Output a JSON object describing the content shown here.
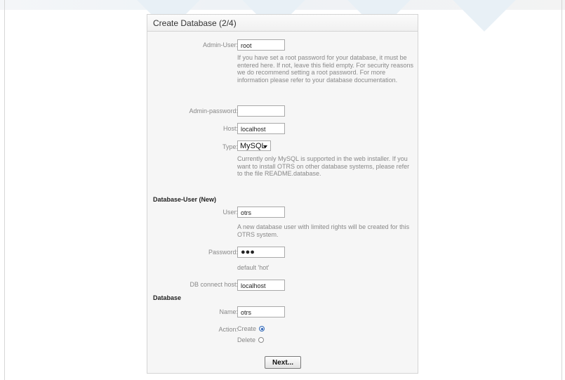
{
  "widget": {
    "title": "Create Database (2/4)"
  },
  "admin_user": {
    "label": "Admin-User:",
    "value": "root",
    "help": "If you have set a root password for your database, it must be entered here. If not, leave this field empty. For security reasons we do recommend setting a root password. For more information please refer to your database documentation."
  },
  "admin_password": {
    "label": "Admin-password:",
    "value": ""
  },
  "host": {
    "label": "Host:",
    "value": "localhost"
  },
  "type": {
    "label": "Type:",
    "selected": "MySQL",
    "help": "Currently only MySQL is supported in the web installer. If you want to install OTRS on other database systems, please refer to the file README.database."
  },
  "db_user_section": {
    "title": "Database-User (New)"
  },
  "db_user": {
    "label": "User:",
    "value": "otrs",
    "help": "A new database user with limited rights will be created for this OTRS system."
  },
  "db_password": {
    "label": "Password:",
    "value": "●●●",
    "help": "default 'hot'"
  },
  "db_connect_host": {
    "label": "DB connect host:",
    "value": "localhost"
  },
  "database_section": {
    "title": "Database"
  },
  "db_name": {
    "label": "Name:",
    "value": "otrs"
  },
  "action": {
    "label": "Action:",
    "options": [
      {
        "label": "Create",
        "checked": true
      },
      {
        "label": "Delete",
        "checked": false
      }
    ]
  },
  "buttons": {
    "next_label": "Next..."
  }
}
